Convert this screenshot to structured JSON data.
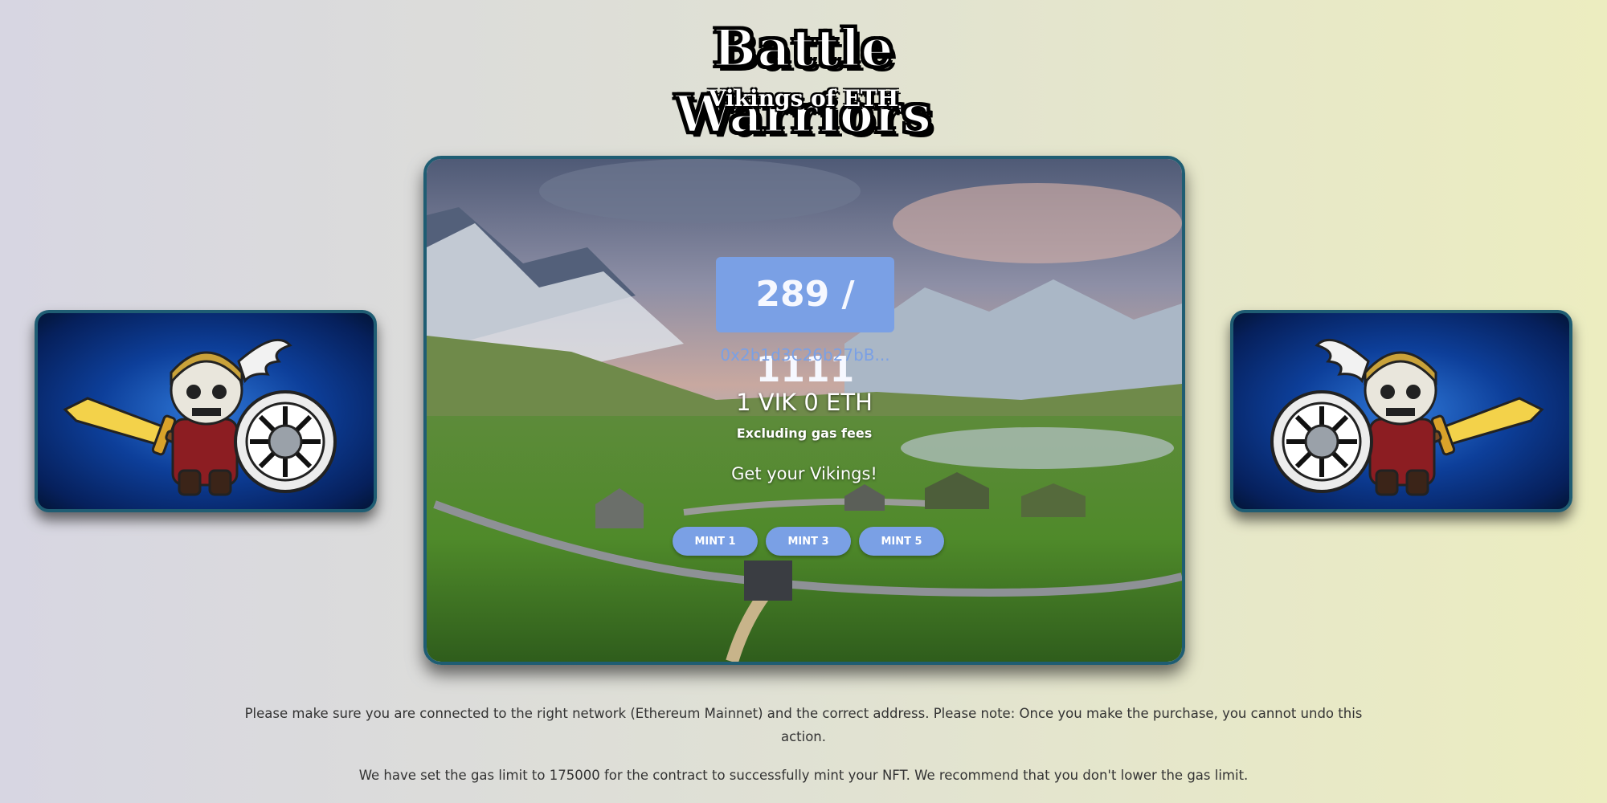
{
  "logo": {
    "title": "Battle Warriors",
    "subtitle": "Vikings of ETH"
  },
  "mint": {
    "counter": "289 / 1111",
    "contract_address": "0x2b1d3C26b27bB...",
    "price": "1 VIK 0 ETH",
    "gas_note": "Excluding gas fees",
    "cta": "Get your Vikings!",
    "buttons": [
      "MINT 1",
      "MINT 3",
      "MINT 5"
    ]
  },
  "notices": {
    "network": "Please make sure you are connected to the right network (Ethereum Mainnet) and the correct address. Please note: Once you make the purchase, you cannot undo this action.",
    "gas_limit": "We have set the gas limit to 175000 for the contract to successfully mint your NFT. We recommend that you don't lower the gas limit."
  },
  "colors": {
    "accent": "#7aa0e5",
    "card_border": "#1f5d73",
    "text": "#333333"
  },
  "icons": {
    "side_cards": "viking-warrior-illustration",
    "background": "viking-village-landscape"
  }
}
